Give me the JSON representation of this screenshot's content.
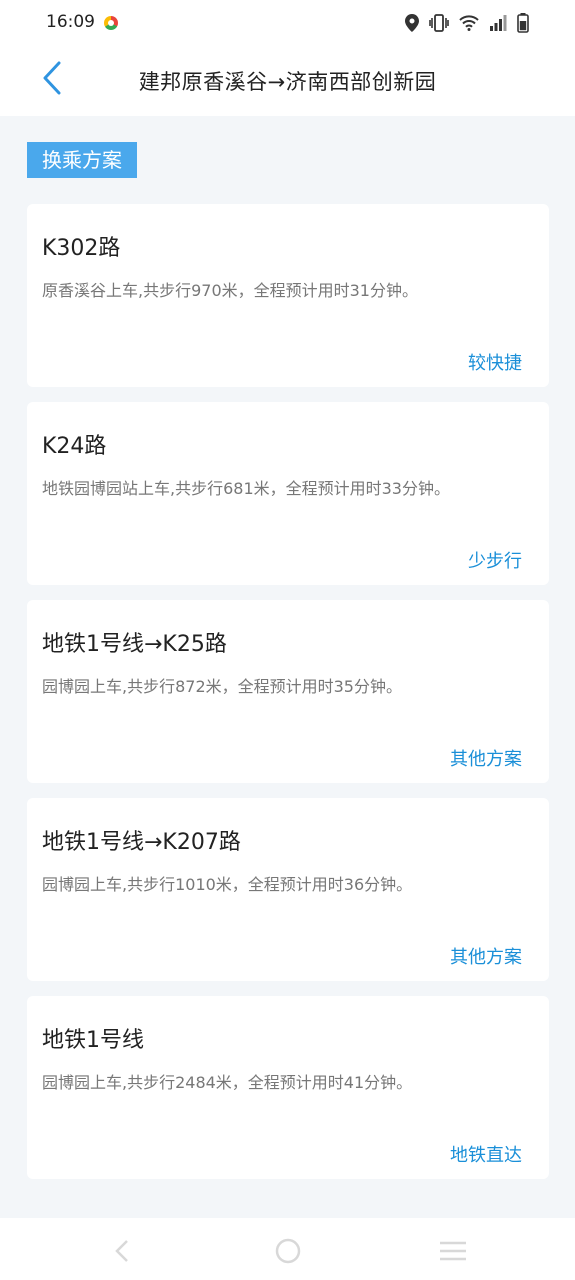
{
  "status_bar": {
    "time": "16:09",
    "icons": [
      "colored-app-icon",
      "location-icon",
      "vibrate-icon",
      "wifi-icon",
      "signal-icon",
      "battery-icon"
    ]
  },
  "header": {
    "back_icon": "chevron-left-icon",
    "title": "建邦原香溪谷→济南西部创新园"
  },
  "section_tag": "换乘方案",
  "routes": [
    {
      "title": "K302路",
      "desc": "原香溪谷上车,共步行970米，全程预计用时31分钟。",
      "tag": "较快捷"
    },
    {
      "title": "K24路",
      "desc": "地铁园博园站上车,共步行681米，全程预计用时33分钟。",
      "tag": "少步行"
    },
    {
      "title": "地铁1号线→K25路",
      "desc": "园博园上车,共步行872米，全程预计用时35分钟。",
      "tag": "其他方案"
    },
    {
      "title": "地铁1号线→K207路",
      "desc": "园博园上车,共步行1010米，全程预计用时36分钟。",
      "tag": "其他方案"
    },
    {
      "title": "地铁1号线",
      "desc": "园博园上车,共步行2484米，全程预计用时41分钟。",
      "tag": "地铁直达"
    }
  ],
  "nav_bar": {
    "icons": [
      "back-nav-icon",
      "home-nav-icon",
      "menu-nav-icon"
    ]
  },
  "colors": {
    "accent": "#4aa8ec",
    "tag_text": "#1a8fd8",
    "background": "#f3f6f9"
  }
}
